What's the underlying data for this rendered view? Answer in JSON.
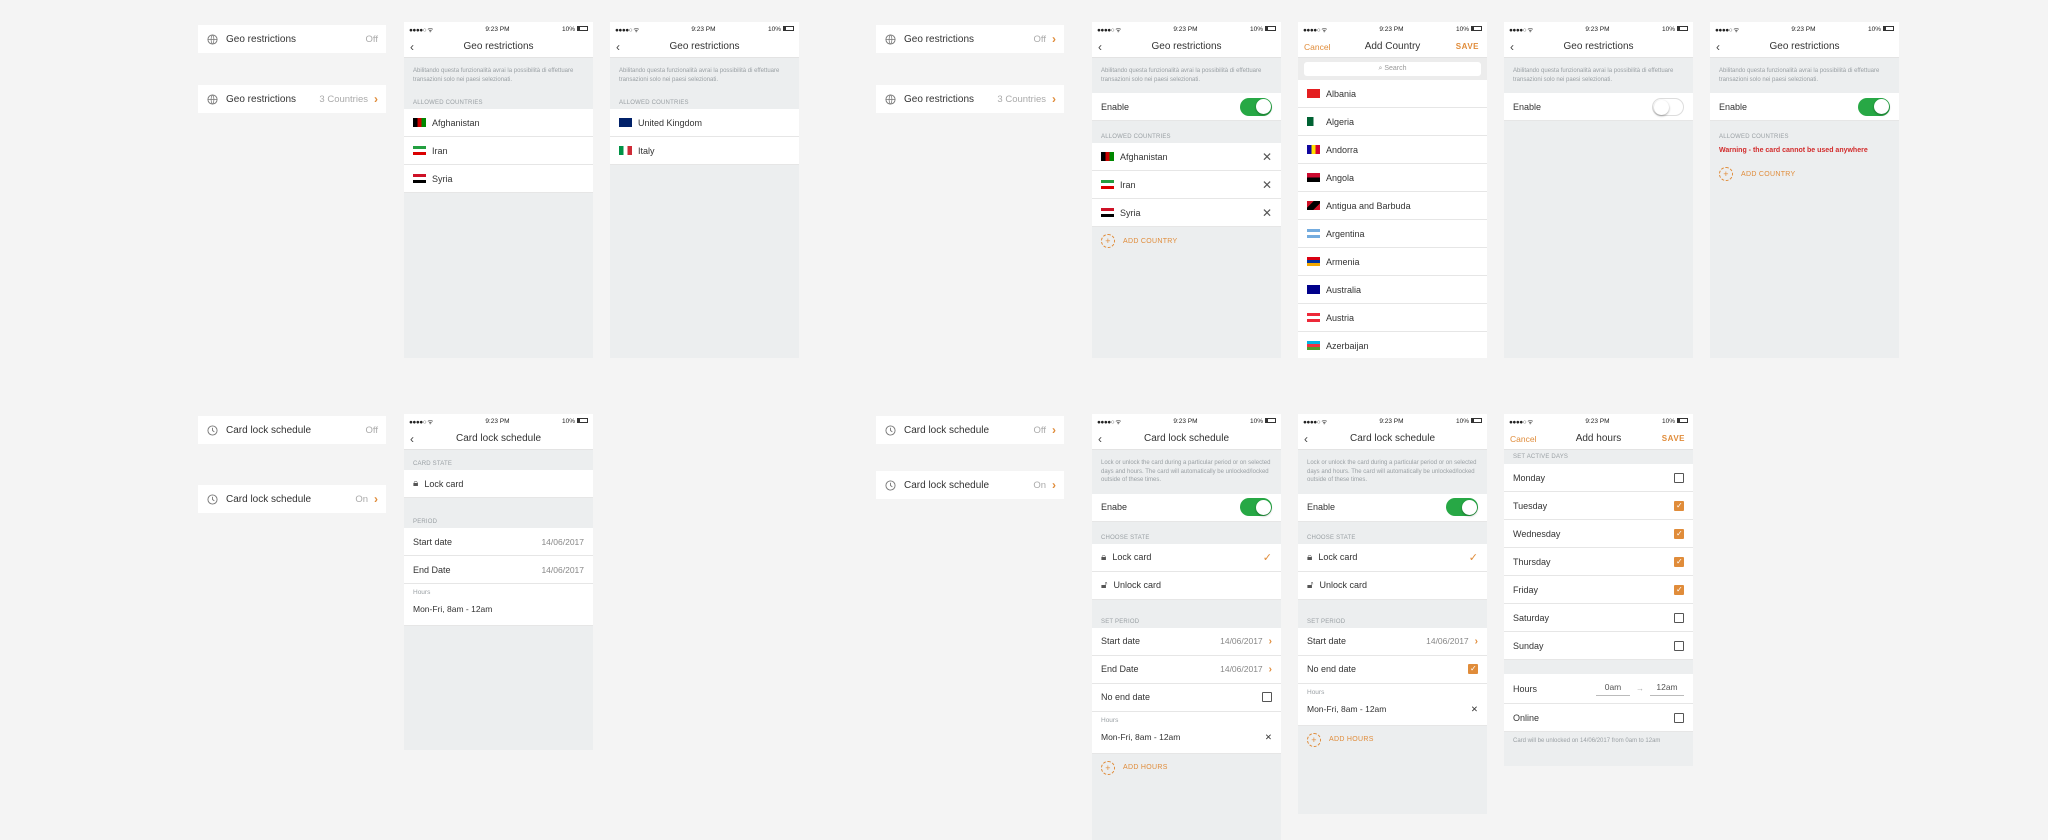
{
  "status": {
    "time": "9:23 PM",
    "battery": "10%"
  },
  "summary": {
    "geo_title": "Geo restrictions",
    "geo_off": "Off",
    "geo_countries": "3 Countries",
    "lock_title": "Card lock schedule",
    "lock_off": "Off",
    "lock_on": "On"
  },
  "geo": {
    "title": "Geo restrictions",
    "desc": "Abilitando questa funzionalità avrai la possibilità di effettuare transazioni solo nei paesi selezionati.",
    "allowed_label": "ALLOWED COUNTRIES",
    "enable_label": "Enable",
    "add_country": "ADD COUNTRY",
    "warning": "Warning - the card cannot be used anywhere",
    "list_a": [
      "Afghanistan",
      "Iran",
      "Syria"
    ],
    "list_b": [
      "United Kingdom",
      "Italy"
    ]
  },
  "add_country": {
    "cancel": "Cancel",
    "title": "Add Country",
    "save": "SAVE",
    "search_placeholder": "Search",
    "countries": [
      "Albania",
      "Algeria",
      "Andorra",
      "Angola",
      "Antigua and Barbuda",
      "Argentina",
      "Armenia",
      "Australia",
      "Austria",
      "Azerbaijan"
    ]
  },
  "lock": {
    "title": "Card lock schedule",
    "card_state_label": "CARD STATE",
    "lock_card": "Lock card",
    "unlock_card": "Unlock card",
    "period_label": "PERIOD",
    "set_period_label": "SET PERIOD",
    "choose_state_label": "CHOOSE STATE",
    "start_date": "Start date",
    "end_date": "End Date",
    "date_value": "14/06/2017",
    "no_end_date": "No end date",
    "hours_label": "Hours",
    "hours_value": "Mon-Fri, 8am - 12am",
    "enable_label_a": "Enabe",
    "enable_label_b": "Enable",
    "add_hours": "ADD HOURS",
    "desc": "Lock or unlock the card during a particular period or on selected days and hours. The card will automatically be unlocked/locked outside of these times."
  },
  "add_hours": {
    "cancel": "Cancel",
    "title": "Add hours",
    "save": "SAVE",
    "days_label": "SET ACTIVE DAYS",
    "days": [
      {
        "name": "Monday",
        "checked": false
      },
      {
        "name": "Tuesday",
        "checked": true
      },
      {
        "name": "Wednesday",
        "checked": true
      },
      {
        "name": "Thursday",
        "checked": true
      },
      {
        "name": "Friday",
        "checked": true
      },
      {
        "name": "Saturday",
        "checked": false
      },
      {
        "name": "Sunday",
        "checked": false
      }
    ],
    "hours_label": "Hours",
    "from": "0am",
    "dash": "→",
    "to": "12am",
    "online": "Online",
    "note": "Card will be unlocked on 14/06/2017 from 0am to 12am"
  },
  "colors": {
    "accent": "#e08c3a",
    "toggle_on": "#27a845",
    "warning": "#d22b2b"
  }
}
